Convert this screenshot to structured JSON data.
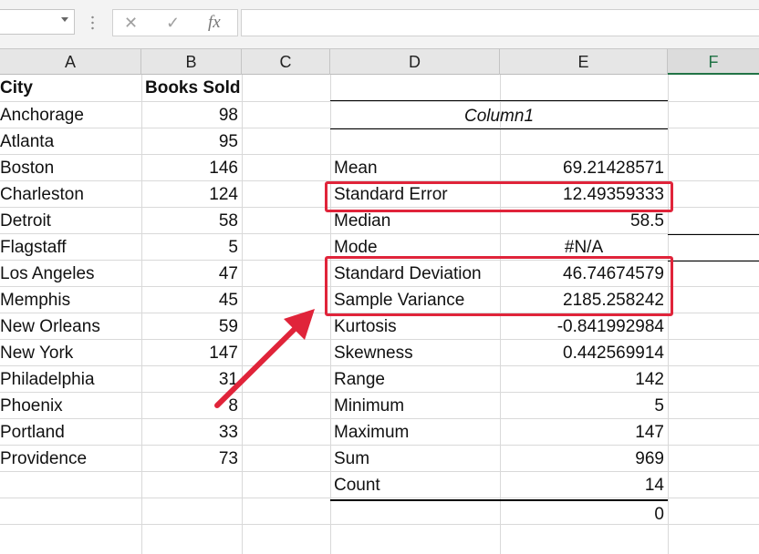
{
  "formula_bar": {
    "cancel_glyph": "✕",
    "enter_glyph": "✓",
    "fx_label": "fx",
    "formula_value": ""
  },
  "columns": [
    "A",
    "B",
    "C",
    "D",
    "E",
    "F"
  ],
  "selected_column": "F",
  "table": {
    "headers": {
      "city": "City",
      "books_sold": "Books Sold"
    },
    "rows": [
      {
        "city": "Anchorage",
        "books": "98"
      },
      {
        "city": "Atlanta",
        "books": "95"
      },
      {
        "city": "Boston",
        "books": "146"
      },
      {
        "city": "Charleston",
        "books": "124"
      },
      {
        "city": "Detroit",
        "books": "58"
      },
      {
        "city": "Flagstaff",
        "books": "5"
      },
      {
        "city": "Los Angeles",
        "books": "47"
      },
      {
        "city": "Memphis",
        "books": "45"
      },
      {
        "city": "New Orleans",
        "books": "59"
      },
      {
        "city": "New York",
        "books": "147"
      },
      {
        "city": "Philadelphia",
        "books": "31"
      },
      {
        "city": "Phoenix",
        "books": "8"
      },
      {
        "city": "Portland",
        "books": "33"
      },
      {
        "city": "Providence",
        "books": "73"
      }
    ]
  },
  "stats": {
    "header": "Column1",
    "rows": [
      {
        "label": "Mean",
        "value": "69.21428571"
      },
      {
        "label": "Standard Error",
        "value": "12.49359333"
      },
      {
        "label": "Median",
        "value": "58.5"
      },
      {
        "label": "Mode",
        "value": "#N/A"
      },
      {
        "label": "Standard Deviation",
        "value": "46.74674579"
      },
      {
        "label": "Sample Variance",
        "value": "2185.258242"
      },
      {
        "label": "Kurtosis",
        "value": "-0.841992984"
      },
      {
        "label": "Skewness",
        "value": "0.442569914"
      },
      {
        "label": "Range",
        "value": "142"
      },
      {
        "label": "Minimum",
        "value": "5"
      },
      {
        "label": "Maximum",
        "value": "147"
      },
      {
        "label": "Sum",
        "value": "969"
      },
      {
        "label": "Count",
        "value": "14"
      }
    ],
    "extra_value": "0"
  },
  "annotation_color": "#e0243a",
  "excel_accent": "#217346"
}
